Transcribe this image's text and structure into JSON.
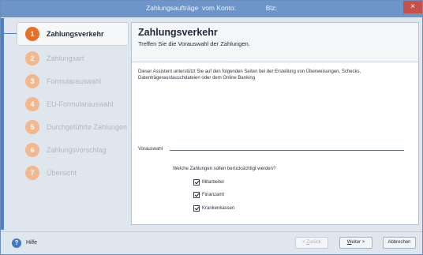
{
  "window": {
    "title": "Zahlungsaufträge  vom Konto:                Blz:",
    "close_glyph": "×"
  },
  "steps": [
    {
      "num": "1",
      "label": "Zahlungsverkehr",
      "active": true
    },
    {
      "num": "2",
      "label": "Zahlungsart",
      "active": false
    },
    {
      "num": "3",
      "label": "Formularauswahl",
      "active": false
    },
    {
      "num": "4",
      "label": "EU-Formularauswahl",
      "active": false
    },
    {
      "num": "5",
      "label": "Durchgeführte Zahlungen",
      "active": false
    },
    {
      "num": "6",
      "label": "Zahlungsvorschlag",
      "active": false
    },
    {
      "num": "7",
      "label": "Übersicht",
      "active": false
    }
  ],
  "main": {
    "title": "Zahlungsverkehr",
    "subtitle": "Treffen Sie die Vorauswahl der Zahlungen.",
    "description": "Dieser Assistent unterstützt Sie auf den folgenden Seiten bei der Erstellung von Überweisungen, Schecks, Datenträgeraustauschdateien oder dem Online Banking",
    "group_label": "Vorauswahl",
    "question": "Welche Zahlungen sollen berücksichtigt werden?",
    "checkboxes": [
      {
        "label": "Mitarbeiter",
        "checked": true
      },
      {
        "label": "Finanzamt",
        "checked": true
      },
      {
        "label": "Krankenkassen",
        "checked": true
      }
    ]
  },
  "footer": {
    "help_label": "Hilfe",
    "help_icon": "?",
    "back_prefix": "< ",
    "back_u": "Z",
    "back_rest": "urück",
    "next_u": "W",
    "next_rest": "eiter >",
    "cancel_label": "Abbrechen"
  },
  "colors": {
    "titlebar": "#6d95c8",
    "active_step": "#e4702c",
    "inactive_step": "#f3b88e",
    "close": "#c7504a"
  }
}
